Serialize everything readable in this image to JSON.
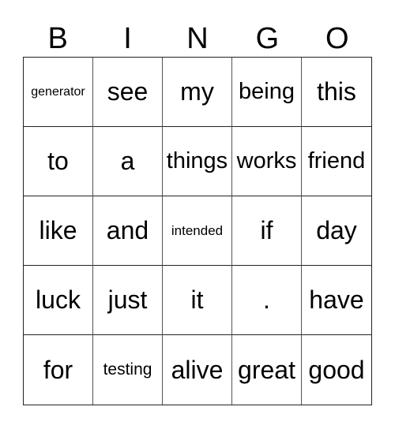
{
  "header": [
    "B",
    "I",
    "N",
    "G",
    "O"
  ],
  "cells": [
    [
      "generator",
      "see",
      "my",
      "being",
      "this"
    ],
    [
      "to",
      "a",
      "things",
      "works",
      "friend"
    ],
    [
      "like",
      "and",
      "intended",
      "if",
      "day"
    ],
    [
      "luck",
      "just",
      "it",
      ".",
      "have"
    ],
    [
      "for",
      "testing",
      "alive",
      "great",
      "good"
    ]
  ]
}
